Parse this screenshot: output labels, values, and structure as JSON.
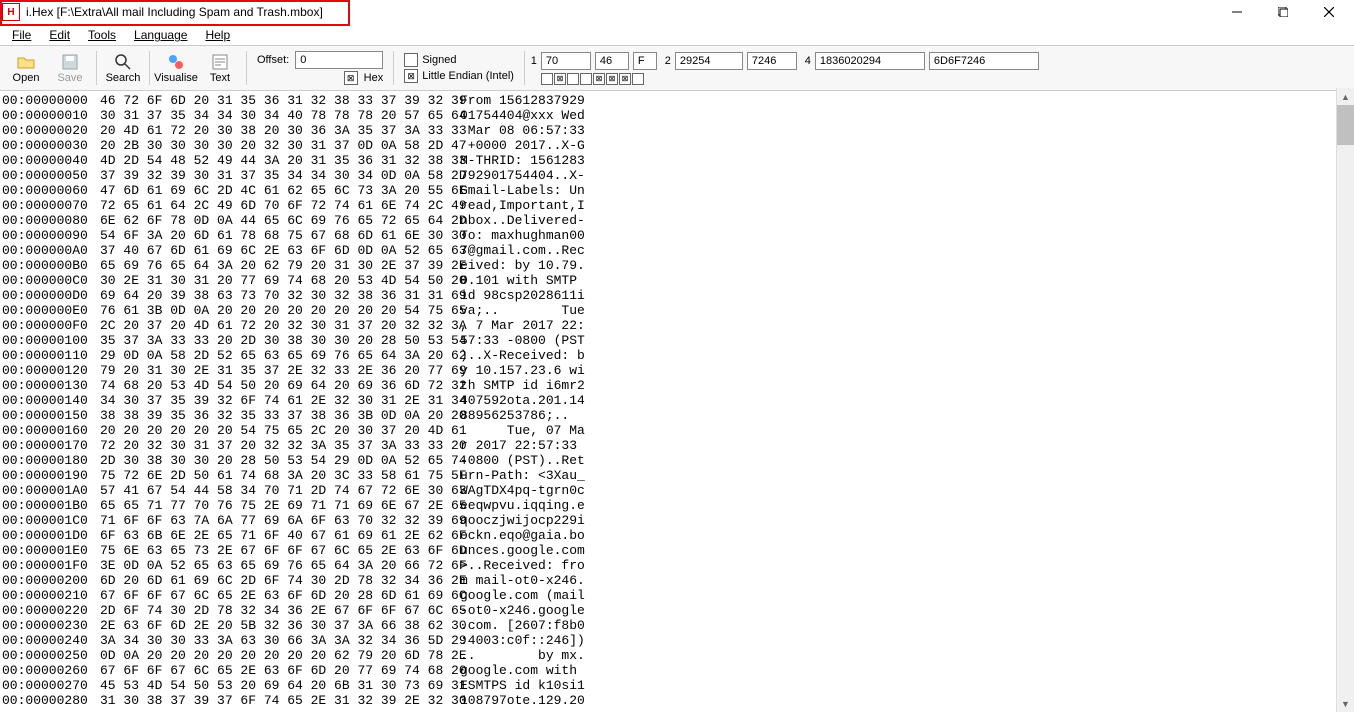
{
  "window": {
    "title": "i.Hex [F:\\Extra\\All mail Including Spam and Trash.mbox]"
  },
  "menu": {
    "file": "File",
    "edit": "Edit",
    "tools": "Tools",
    "language": "Language",
    "help": "Help"
  },
  "toolbar": {
    "open": "Open",
    "save": "Save",
    "search": "Search",
    "visualise": "Visualise",
    "text": "Text",
    "offset_label": "Offset:",
    "offset_value": "0",
    "hex_label": "Hex",
    "hex_checked": "⊠",
    "signed_label": "Signed",
    "signed_checked": "",
    "endian_label": "Little Endian (Intel)",
    "endian_checked": "⊠",
    "int1": {
      "lab": "1",
      "a": "70",
      "b": "46",
      "c": "F"
    },
    "int2": {
      "lab": "2",
      "a": "29254",
      "b": "7246"
    },
    "int4": {
      "lab": "4",
      "a": "1836020294",
      "b": "6D6F7246"
    }
  },
  "hex": {
    "rows": [
      {
        "addr": "00:00000000",
        "hex": "46 72 6F 6D 20 31 35 36 31 32 38 33 37 39 32 39",
        "ascii": "From 15612837929"
      },
      {
        "addr": "00:00000010",
        "hex": "30 31 37 35 34 34 30 34 40 78 78 78 20 57 65 64",
        "ascii": "01754404@xxx Wed"
      },
      {
        "addr": "00:00000020",
        "hex": "20 4D 61 72 20 30 38 20 30 36 3A 35 37 3A 33 33",
        "ascii": " Mar 08 06:57:33"
      },
      {
        "addr": "00:00000030",
        "hex": "20 2B 30 30 30 30 20 32 30 31 37 0D 0A 58 2D 47",
        "ascii": " +0000 2017..X-G"
      },
      {
        "addr": "00:00000040",
        "hex": "4D 2D 54 48 52 49 44 3A 20 31 35 36 31 32 38 33",
        "ascii": "M-THRID: 1561283"
      },
      {
        "addr": "00:00000050",
        "hex": "37 39 32 39 30 31 37 35 34 34 30 34 0D 0A 58 2D",
        "ascii": "792901754404..X-"
      },
      {
        "addr": "00:00000060",
        "hex": "47 6D 61 69 6C 2D 4C 61 62 65 6C 73 3A 20 55 6E",
        "ascii": "Gmail-Labels: Un"
      },
      {
        "addr": "00:00000070",
        "hex": "72 65 61 64 2C 49 6D 70 6F 72 74 61 6E 74 2C 49",
        "ascii": "read,Important,I"
      },
      {
        "addr": "00:00000080",
        "hex": "6E 62 6F 78 0D 0A 44 65 6C 69 76 65 72 65 64 2D",
        "ascii": "nbox..Delivered-"
      },
      {
        "addr": "00:00000090",
        "hex": "54 6F 3A 20 6D 61 78 68 75 67 68 6D 61 6E 30 30",
        "ascii": "To: maxhughman00"
      },
      {
        "addr": "00:000000A0",
        "hex": "37 40 67 6D 61 69 6C 2E 63 6F 6D 0D 0A 52 65 63",
        "ascii": "7@gmail.com..Rec"
      },
      {
        "addr": "00:000000B0",
        "hex": "65 69 76 65 64 3A 20 62 79 20 31 30 2E 37 39 2E",
        "ascii": "eived: by 10.79."
      },
      {
        "addr": "00:000000C0",
        "hex": "30 2E 31 30 31 20 77 69 74 68 20 53 4D 54 50 20",
        "ascii": "0.101 with SMTP "
      },
      {
        "addr": "00:000000D0",
        "hex": "69 64 20 39 38 63 73 70 32 30 32 38 36 31 31 69",
        "ascii": "id 98csp2028611i"
      },
      {
        "addr": "00:000000E0",
        "hex": "76 61 3B 0D 0A 20 20 20 20 20 20 20 20 54 75 65",
        "ascii": "va;..        Tue"
      },
      {
        "addr": "00:000000F0",
        "hex": "2C 20 37 20 4D 61 72 20 32 30 31 37 20 32 32 3A",
        "ascii": ", 7 Mar 2017 22:"
      },
      {
        "addr": "00:00000100",
        "hex": "35 37 3A 33 33 20 2D 30 38 30 30 20 28 50 53 54",
        "ascii": "57:33 -0800 (PST"
      },
      {
        "addr": "00:00000110",
        "hex": "29 0D 0A 58 2D 52 65 63 65 69 76 65 64 3A 20 62",
        "ascii": ")..X-Received: b"
      },
      {
        "addr": "00:00000120",
        "hex": "79 20 31 30 2E 31 35 37 2E 32 33 2E 36 20 77 69",
        "ascii": "y 10.157.23.6 wi"
      },
      {
        "addr": "00:00000130",
        "hex": "74 68 20 53 4D 54 50 20 69 64 20 69 36 6D 72 32",
        "ascii": "th SMTP id i6mr2"
      },
      {
        "addr": "00:00000140",
        "hex": "34 30 37 35 39 32 6F 74 61 2E 32 30 31 2E 31 34",
        "ascii": "407592ota.201.14"
      },
      {
        "addr": "00:00000150",
        "hex": "38 38 39 35 36 32 35 33 37 38 36 3B 0D 0A 20 20",
        "ascii": "88956253786;..  "
      },
      {
        "addr": "00:00000160",
        "hex": "20 20 20 20 20 20 54 75 65 2C 20 30 37 20 4D 61",
        "ascii": "      Tue, 07 Ma"
      },
      {
        "addr": "00:00000170",
        "hex": "72 20 32 30 31 37 20 32 32 3A 35 37 3A 33 33 20",
        "ascii": "r 2017 22:57:33 "
      },
      {
        "addr": "00:00000180",
        "hex": "2D 30 38 30 30 20 28 50 53 54 29 0D 0A 52 65 74",
        "ascii": "-0800 (PST)..Ret"
      },
      {
        "addr": "00:00000190",
        "hex": "75 72 6E 2D 50 61 74 68 3A 20 3C 33 58 61 75 5F",
        "ascii": "urn-Path: <3Xau_"
      },
      {
        "addr": "00:000001A0",
        "hex": "57 41 67 54 44 58 34 70 71 2D 74 67 72 6E 30 63",
        "ascii": "WAgTDX4pq-tgrn0c"
      },
      {
        "addr": "00:000001B0",
        "hex": "65 65 71 77 70 76 75 2E 69 71 71 69 6E 67 2E 65",
        "ascii": "eeqwpvu.iqqing.e"
      },
      {
        "addr": "00:000001C0",
        "hex": "71 6F 6F 63 7A 6A 77 69 6A 6F 63 70 32 32 39 69",
        "ascii": "qooczjwijocp229i"
      },
      {
        "addr": "00:000001D0",
        "hex": "6F 63 6B 6E 2E 65 71 6F 40 67 61 69 61 2E 62 6F",
        "ascii": "ockn.eqo@gaia.bo"
      },
      {
        "addr": "00:000001E0",
        "hex": "75 6E 63 65 73 2E 67 6F 6F 67 6C 65 2E 63 6F 6D",
        "ascii": "unces.google.com"
      },
      {
        "addr": "00:000001F0",
        "hex": "3E 0D 0A 52 65 63 65 69 76 65 64 3A 20 66 72 6F",
        "ascii": ">..Received: fro"
      },
      {
        "addr": "00:00000200",
        "hex": "6D 20 6D 61 69 6C 2D 6F 74 30 2D 78 32 34 36 2E",
        "ascii": "m mail-ot0-x246."
      },
      {
        "addr": "00:00000210",
        "hex": "67 6F 6F 67 6C 65 2E 63 6F 6D 20 28 6D 61 69 6C",
        "ascii": "google.com (mail"
      },
      {
        "addr": "00:00000220",
        "hex": "2D 6F 74 30 2D 78 32 34 36 2E 67 6F 6F 67 6C 65",
        "ascii": "-ot0-x246.google"
      },
      {
        "addr": "00:00000230",
        "hex": "2E 63 6F 6D 2E 20 5B 32 36 30 37 3A 66 38 62 30",
        "ascii": ".com. [2607:f8b0"
      },
      {
        "addr": "00:00000240",
        "hex": "3A 34 30 30 33 3A 63 30 66 3A 3A 32 34 36 5D 29",
        "ascii": ":4003:c0f::246])"
      },
      {
        "addr": "00:00000250",
        "hex": "0D 0A 20 20 20 20 20 20 20 20 62 79 20 6D 78 2E",
        "ascii": "..        by mx."
      },
      {
        "addr": "00:00000260",
        "hex": "67 6F 6F 67 6C 65 2E 63 6F 6D 20 77 69 74 68 20",
        "ascii": "google.com with "
      },
      {
        "addr": "00:00000270",
        "hex": "45 53 4D 54 50 53 20 69 64 20 6B 31 30 73 69 31",
        "ascii": "ESMTPS id k10si1"
      },
      {
        "addr": "00:00000280",
        "hex": "31 30 38 37 39 37 6F 74 65 2E 31 32 39 2E 32 30",
        "ascii": "108797ote.129.20"
      }
    ]
  }
}
